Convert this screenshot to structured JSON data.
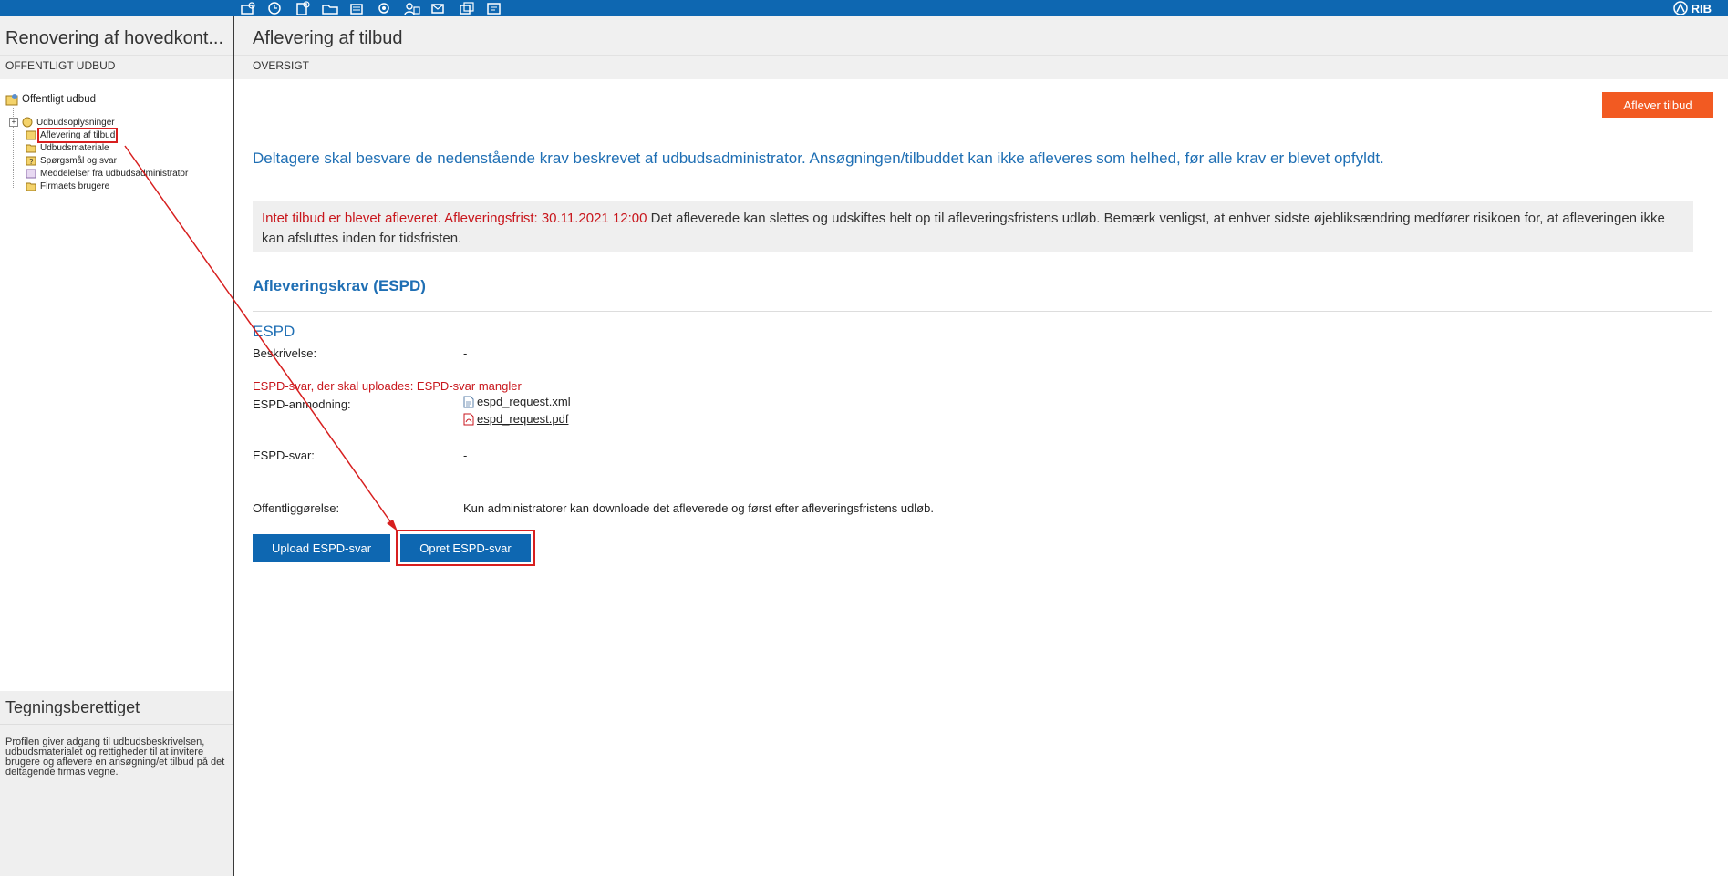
{
  "topbar": {
    "brand": "RIB",
    "tool_icons": [
      "tool-icon-1",
      "tool-icon-2",
      "tool-icon-3",
      "tool-icon-4",
      "tool-icon-5",
      "tool-icon-6",
      "tool-icon-7",
      "tool-icon-8",
      "tool-icon-9",
      "tool-icon-10"
    ]
  },
  "sidebar": {
    "title": "Renovering af hovedkont...",
    "subtitle": "OFFENTLIGT UDBUD",
    "tree": {
      "root": "Offentligt udbud",
      "items": [
        {
          "label": "Udbudsoplysninger"
        },
        {
          "label": "Aflevering af tilbud"
        },
        {
          "label": "Udbudsmateriale"
        },
        {
          "label": "Spørgsmål og svar"
        },
        {
          "label": "Meddelelser fra udbudsadministrator"
        },
        {
          "label": "Firmaets brugere"
        }
      ]
    },
    "bottom": {
      "title": "Tegningsberettiget",
      "text": "Profilen giver adgang til udbudsbeskrivelsen, udbudsmaterialet og rettigheder til at invitere brugere og aflevere en ansøgning/et tilbud på det deltagende firmas vegne."
    }
  },
  "main": {
    "title": "Aflevering af tilbud",
    "subtitle": "OVERSIGT",
    "submit_button": "Aflever tilbud",
    "intro": "Deltagere skal besvare de nedenstående krav beskrevet af udbudsadministrator. Ansøgningen/tilbuddet kan ikke afleveres som helhed, før alle krav er blevet opfyldt.",
    "alert_red": "Intet tilbud er blevet afleveret. Afleveringsfrist: 30.11.2021 12:00",
    "alert_text": " Det afleverede kan slettes og udskiftes helt op til afleveringsfristens udløb. Bemærk venligst, at enhver sidste øjebliksændring medfører risikoen for, at afleveringen ikke kan afsluttes inden for tidsfristen.",
    "section_title": "Afleveringskrav (ESPD)",
    "espd": {
      "title": "ESPD",
      "description_label": "Beskrivelse:",
      "description_value": "-",
      "missing": "ESPD-svar, der skal uploades: ESPD-svar mangler",
      "request_label": "ESPD-anmodning:",
      "files": [
        "espd_request.xml",
        "espd_request.pdf"
      ],
      "response_label": "ESPD-svar:",
      "response_value": "-",
      "publication_label": "Offentliggørelse:",
      "publication_value": "Kun administratorer kan downloade det afleverede og først efter afleveringsfristens udløb."
    },
    "buttons": {
      "upload": "Upload ESPD-svar",
      "create": "Opret ESPD-svar"
    }
  },
  "colors": {
    "topbar": "#0e67b1",
    "accent_blue": "#1f6fb4",
    "submit_orange": "#f25a22",
    "alert_red": "#c8161c",
    "annotation_red": "#d71f1f"
  }
}
